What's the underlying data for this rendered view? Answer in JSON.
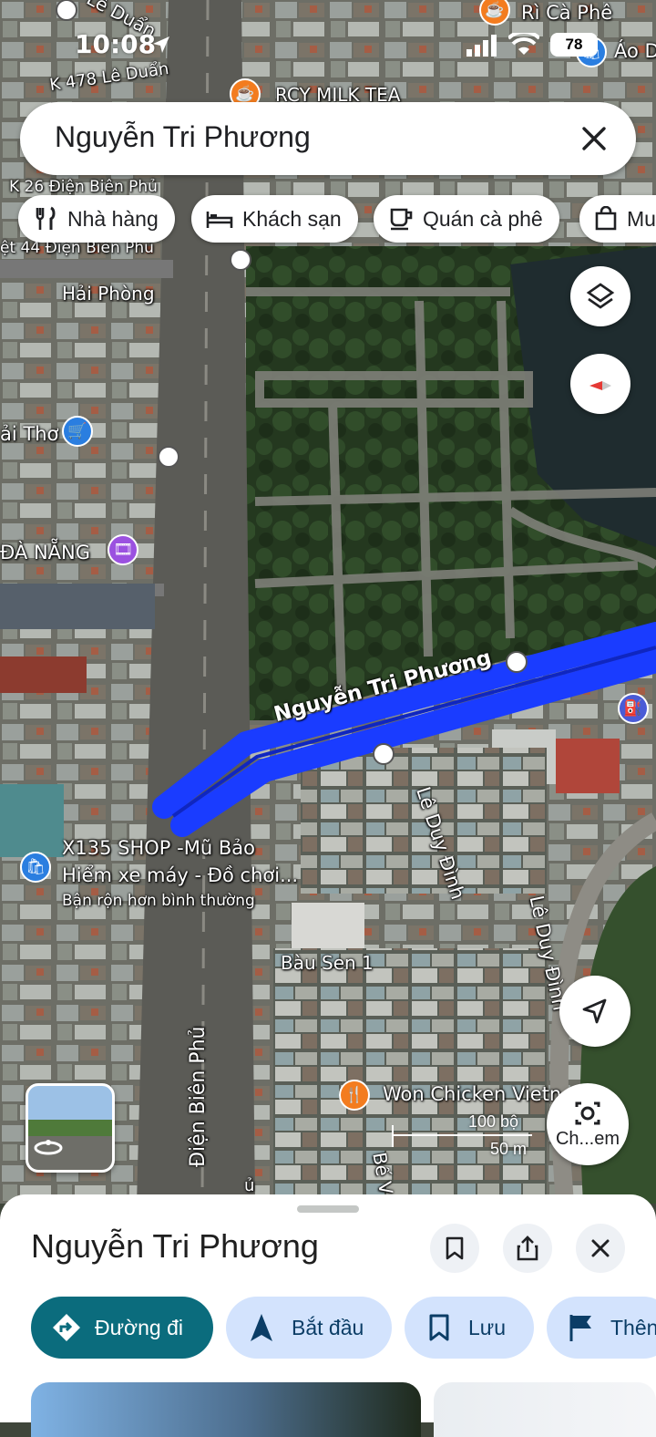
{
  "status_bar": {
    "time": "10:08",
    "battery": "78"
  },
  "search": {
    "query": "Nguyễn Tri Phương"
  },
  "chips": [
    {
      "label": "Nhà hàng",
      "icon": "fork-knife-icon"
    },
    {
      "label": "Khách sạn",
      "icon": "bed-icon"
    },
    {
      "label": "Quán cà phê",
      "icon": "coffee-cup-icon"
    },
    {
      "label": "Mu",
      "icon": "shopping-bag-icon"
    }
  ],
  "map": {
    "street_labels": {
      "le_duan_top": "Lê Duẩn",
      "k478": "K 478 Lê Duẩn",
      "k26": "K 26 Điện Biên Phủ",
      "kiet44": "ệt 44 Điện Biên Phủ",
      "hai_phong": "Hải Phòng",
      "hai_tho": "ải Thơ",
      "da_nang": "ĐÀ NẴNG",
      "nguyen_tri_phuong": "Nguyễn Tri Phương",
      "le_duy_dinh_1": "Lê Duy Đình",
      "le_duy_dinh_2": "Lê Duy Đình",
      "bau_sen": "Bàu Sen 1",
      "dien_bien_phu": "Điện Biên Phủ",
      "be": "Bế V",
      "u": "ủ"
    },
    "pois": {
      "ri_ca_phe": "Rì Cà Phê",
      "rcy": "RCY MILK TEA",
      "ao": "Áo D",
      "x135_line1": "X135 SHOP -Mũ Bảo",
      "x135_line2": "Hiểm xe máy - Đồ chơi...",
      "x135_status": "Bận rộn hơn bình thường",
      "won": "Won Chicken Vietn"
    },
    "scale": {
      "ft": "100 bộ",
      "m": "50 m"
    },
    "camera_label": "Ch...em",
    "route_color": "#1a3cff"
  },
  "sheet": {
    "title": "Nguyễn Tri Phương",
    "actions": [
      {
        "label": "Đường đi",
        "icon": "directions-icon"
      },
      {
        "label": "Bắt đầu",
        "icon": "navigation-arrow-icon"
      },
      {
        "label": "Lưu",
        "icon": "bookmark-icon"
      },
      {
        "label": "Thên",
        "icon": "flag-icon"
      }
    ]
  }
}
